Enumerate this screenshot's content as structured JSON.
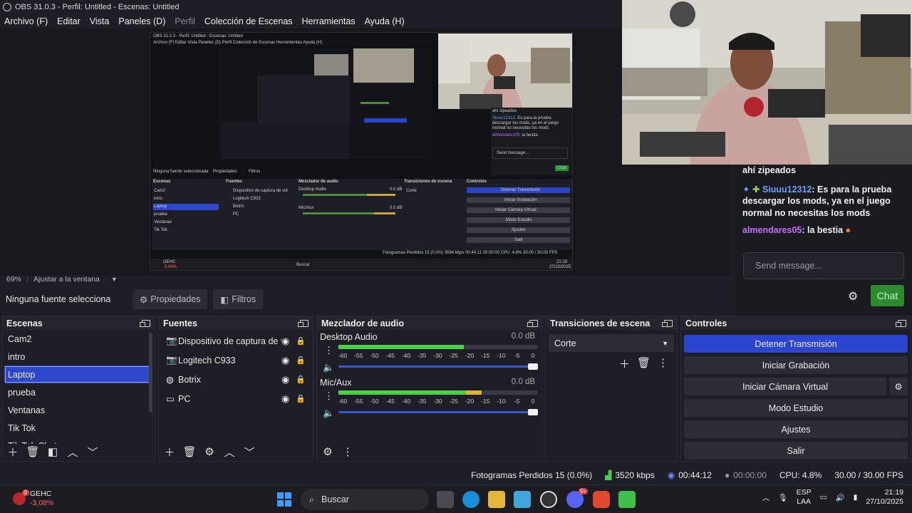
{
  "window": {
    "title": "OBS 31.0.3 - Perfil: Untitled - Escenas: Untitled"
  },
  "menu": [
    "Archivo (F)",
    "Editar",
    "Vista",
    "Paneles (D)",
    "Perfil",
    "Colección de Escenas",
    "Herramientas",
    "Ayuda (H)"
  ],
  "preview": {
    "zoom": "69%",
    "fit": "Ajustar a la ventana",
    "mini_title": "OBS 31.0.3 - Perfil: Untitled - Escenas: Untitled",
    "mini_menu": "Archivo (F)   Editar   Vista   Paneles (D)   Perfil   Colección de Escenas   Herramientas   Ayuda (H)",
    "mini_nosrc": "Ninguna fuente seleccionada",
    "mini_props": "Propiedades",
    "mini_filters": "Filtros",
    "mini_docks": [
      "Escenas",
      "Fuentes",
      "Mezclador de audio",
      "Transiciones de escena",
      "Controles"
    ],
    "mini_scenes": [
      "Cam2",
      "intro",
      "Laptop",
      "prueba",
      "Ventanas",
      "Tik Tok"
    ],
    "mini_sources": [
      "Dispositivo de captura de vid",
      "Logitech C933",
      "Botrix",
      "PC"
    ],
    "mini_audio": [
      "Desktop Audio",
      "Mic/Aux"
    ],
    "mini_db": "0.0 dB",
    "mini_trans": "Corte",
    "mini_controls": [
      "Detener Transmisión",
      "Iniciar Grabación",
      "Iniciar Cámara Virtual",
      "Modo Estudio",
      "Ajustes",
      "Salir"
    ],
    "mini_status": "Fotogramas Perdidos 15 (0.0%)   3594 kbps   00:44:11   00:00:00   CPU: 4.8%   30.00 / 30.00 FPS",
    "mini_chat_1": "ahí zipeados",
    "mini_chat_user": "Siuuu12312",
    "mini_chat_2": ": Es para la prueba descargar los mods, ya en el juego normal no necesitas los mods",
    "mini_chat_user2": "almendares05",
    "mini_chat_3": ": la bestia",
    "mini_send": "Send message...",
    "mini_chatbtn": "Chat",
    "mini_task_stock": "GEHC",
    "mini_task_change": "-3,08%",
    "mini_task_search": "Buscar",
    "mini_time": "21:19",
    "mini_date": "27/10/2025"
  },
  "source_bar": {
    "none_selected": "Ninguna fuente selecciona",
    "properties": "Propiedades",
    "filters": "Filtros"
  },
  "chat": {
    "line1": "ahí zipeados",
    "user1": "Siuuu12312",
    "msg1": ": Es para la prueba descargar los mods, ya en el juego normal no necesitas los mods",
    "user2": "almendares05",
    "msg2": ": la bestia",
    "placeholder": "Send message...",
    "button": "Chat",
    "colors": {
      "user1": "#6aa0ff",
      "user2": "#c86cff",
      "button": "#2d8a2f"
    }
  },
  "scenes": {
    "title": "Escenas",
    "items": [
      "Cam2",
      "intro",
      "Laptop",
      "prueba",
      "Ventanas",
      "Tik Tok",
      "Tik Tok Chat"
    ],
    "selected": "Laptop"
  },
  "sources": {
    "title": "Fuentes",
    "items": [
      {
        "name": "Dispositivo de captura de vid",
        "icon": "camera-icon"
      },
      {
        "name": "Logitech C933",
        "icon": "camera-icon"
      },
      {
        "name": "Botrix",
        "icon": "browser-icon"
      },
      {
        "name": "PC",
        "icon": "monitor-icon"
      }
    ]
  },
  "mixer": {
    "title": "Mezclador de audio",
    "channels": [
      {
        "name": "Desktop Audio",
        "db": "0.0 dB",
        "level": 0.63,
        "volume": 1.0
      },
      {
        "name": "Mic/Aux",
        "db": "0.0 dB",
        "level": 0.72,
        "volume": 1.0
      }
    ],
    "scale": [
      "-60",
      "-55",
      "-50",
      "-45",
      "-40",
      "-35",
      "-30",
      "-25",
      "-20",
      "-15",
      "-10",
      "-5",
      "0"
    ]
  },
  "transitions": {
    "title": "Transiciones de escena",
    "selected": "Corte"
  },
  "controls": {
    "title": "Controles",
    "buttons": [
      "Detener Transmisión",
      "Iniciar Grabación",
      "Iniciar Cámara Virtual",
      "Modo Estudio",
      "Ajustes",
      "Salir"
    ],
    "active": "Detener Transmisión",
    "accent": "#2b45cf"
  },
  "status": {
    "dropped": "Fotogramas Perdidos 15 (0.0%)",
    "bitrate": "3520 kbps",
    "stream_time": "00:44:12",
    "rec_time": "00:00:00",
    "cpu": "CPU: 4.8%",
    "fps": "30.00 / 30.00 FPS"
  },
  "taskbar": {
    "stock": "GEHC",
    "stock_change": "-3,08%",
    "stock_badge": "3",
    "search": "Buscar",
    "lang1": "ESP",
    "lang2": "LAA",
    "time": "21:19",
    "date": "27/10/2025",
    "discord_badge": "9+"
  }
}
